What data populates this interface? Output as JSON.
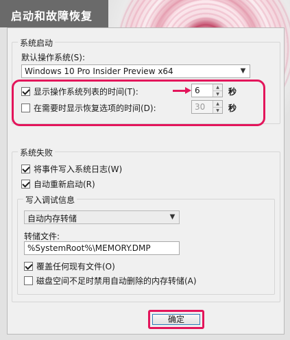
{
  "window": {
    "title": "启动和故障恢复"
  },
  "system_startup": {
    "group_label": "系统启动",
    "default_os_label": "默认操作系统(S):",
    "default_os_value": "Windows 10 Pro Insider Preview x64",
    "show_os_list": {
      "label": "显示操作系统列表的时间(T):",
      "checked": true,
      "value": "6",
      "unit": "秒"
    },
    "show_recovery": {
      "label": "在需要时显示恢复选项的时间(D):",
      "checked": false,
      "value": "30",
      "unit": "秒"
    }
  },
  "system_failure": {
    "group_label": "系统失败",
    "write_event_log": {
      "label": "将事件写入系统日志(W)",
      "checked": true
    },
    "auto_restart": {
      "label": "自动重新启动(R)",
      "checked": true
    },
    "debug_info": {
      "group_label": "写入调试信息",
      "dump_type": "自动内存转储",
      "dump_file_label": "转储文件:",
      "dump_file_value": "%SystemRoot%\\MEMORY.DMP",
      "overwrite": {
        "label": "覆盖任何现有文件(O)",
        "checked": true
      },
      "disable_auto_delete": {
        "label": "磁盘空间不足时禁用自动删除的内存转储(A)",
        "checked": false
      }
    }
  },
  "buttons": {
    "ok_label": "确定"
  },
  "colors": {
    "highlight": "#e3155b",
    "title_bar": "#6a6a6a",
    "dialog_bg": "#f0f0f0"
  }
}
